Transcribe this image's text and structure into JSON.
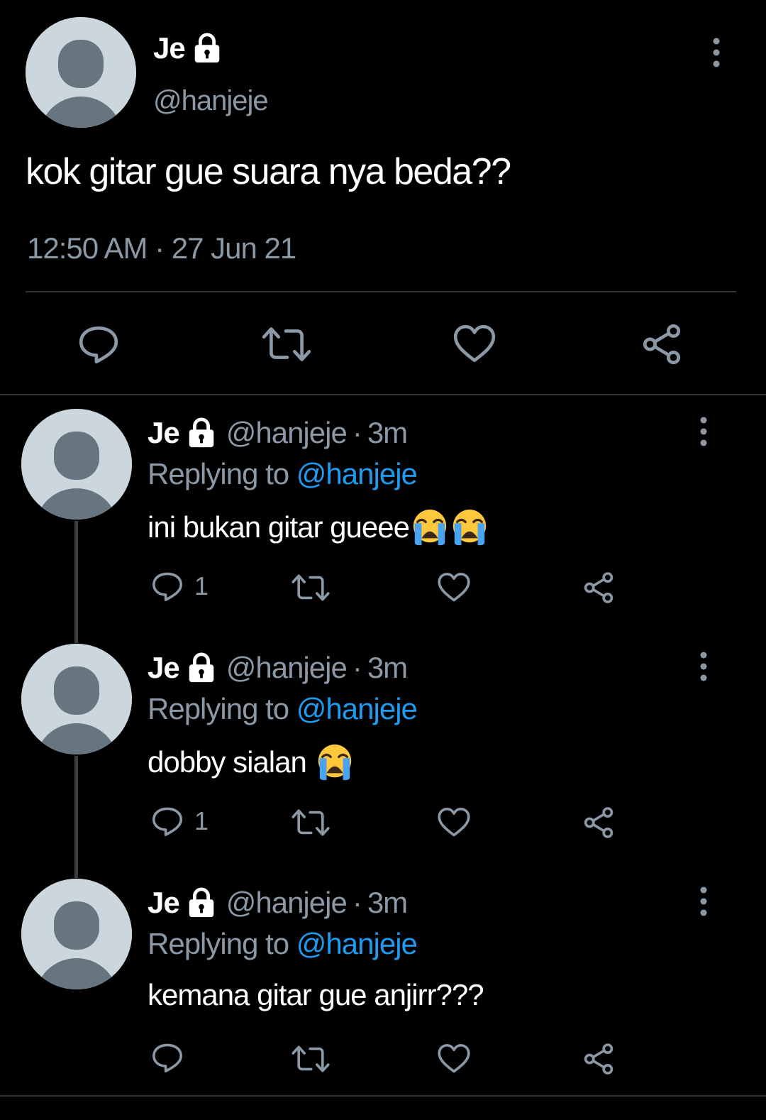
{
  "main_tweet": {
    "display_name": "Je",
    "handle": "@hanjeje",
    "text": "kok gitar gue suara nya beda??",
    "timestamp": "12:50 AM · 27 Jun 21",
    "icons": [
      "lock-icon",
      "more-vertical-icon",
      "reply-icon",
      "retweet-icon",
      "like-icon",
      "share-icon"
    ]
  },
  "replies": [
    {
      "display_name": "Je",
      "handle": "@hanjeje",
      "separator": "·",
      "time": "3m",
      "replying_label": "Replying to",
      "replying_handle": "@hanjeje",
      "text": "ini bukan gitar gueee",
      "emojis": [
        "loudly-crying-face",
        "loudly-crying-face"
      ],
      "reply_count": "1"
    },
    {
      "display_name": "Je",
      "handle": "@hanjeje",
      "separator": "·",
      "time": "3m",
      "replying_label": "Replying to",
      "replying_handle": "@hanjeje",
      "text": "dobby sialan ",
      "emojis": [
        "loudly-crying-face"
      ],
      "reply_count": "1"
    },
    {
      "display_name": "Je",
      "handle": "@hanjeje",
      "separator": "·",
      "time": "3m",
      "replying_label": "Replying to",
      "replying_handle": "@hanjeje",
      "text": "kemana gitar gue anjirr???",
      "emojis": [],
      "reply_count": ""
    }
  ],
  "colors": {
    "background": "#000000",
    "text_primary": "#ffffff",
    "text_secondary": "#8b98a5",
    "link": "#1d9bf0",
    "divider": "#2f3336"
  }
}
